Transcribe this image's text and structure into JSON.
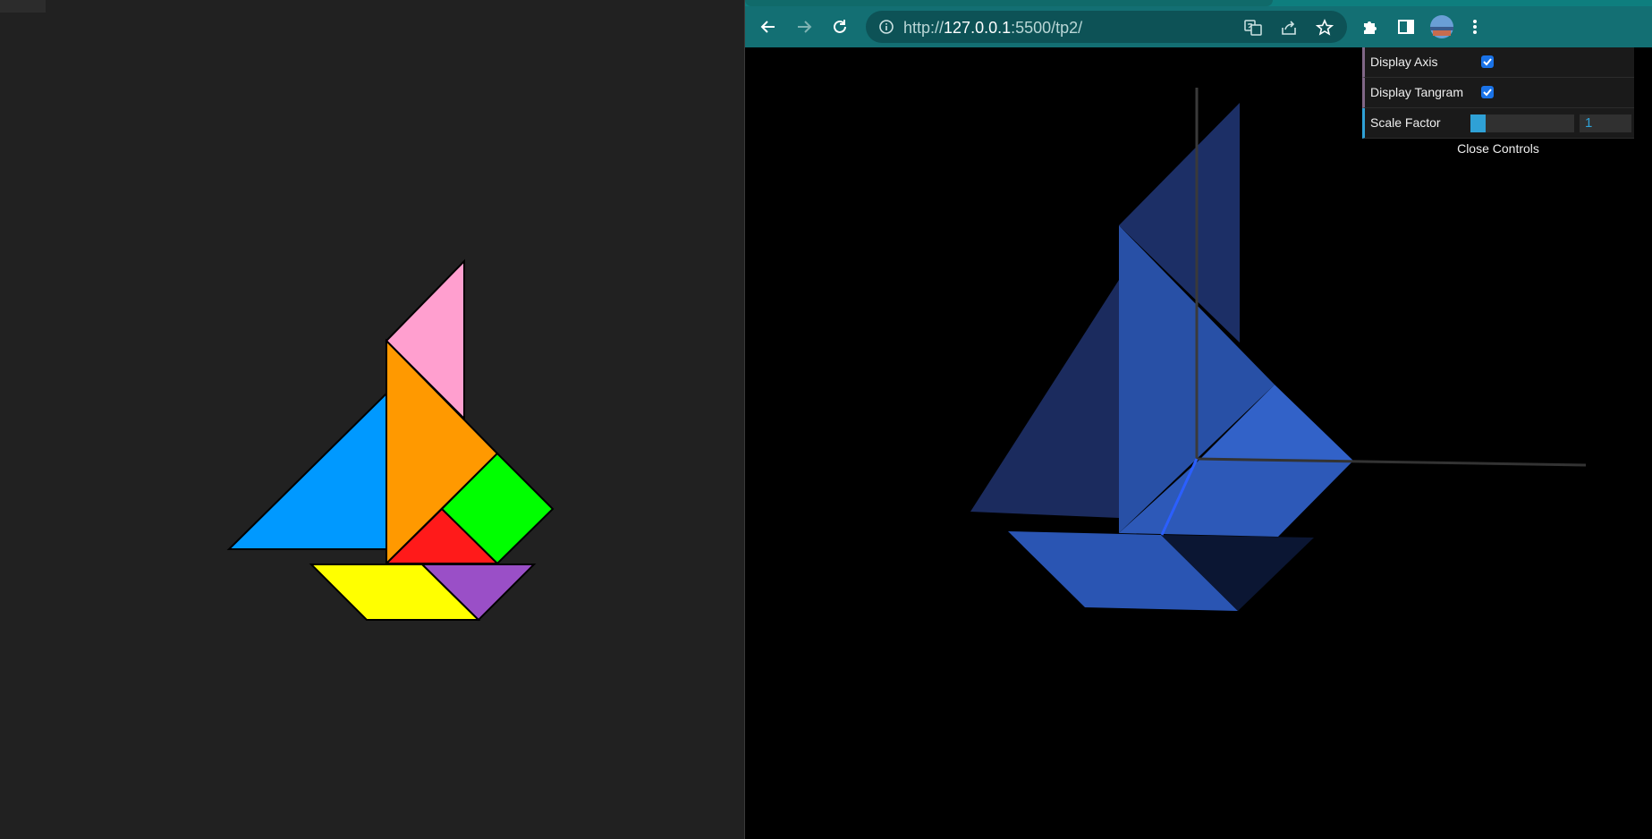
{
  "browser": {
    "url_prefix": "http://",
    "url_host": "127.0.0.1",
    "url_path": ":5500/tp2/"
  },
  "controls": {
    "display_axis_label": "Display Axis",
    "display_axis_checked": true,
    "display_tangram_label": "Display Tangram",
    "display_tangram_checked": true,
    "scale_factor_label": "Scale Factor",
    "scale_factor_value": "1",
    "scale_factor_fill": 0.15,
    "close_label": "Close Controls"
  },
  "colors": {
    "left_background": "#212121",
    "browser_frame": "#136f73",
    "slider_accent": "#2fa1d6",
    "tangram_pink": "#ff9fcf",
    "tangram_orange": "#ff9900",
    "tangram_blue": "#0099ff",
    "tangram_green": "#00ff00",
    "tangram_red": "#ff1a1a",
    "tangram_yellow": "#ffff00",
    "tangram_purple": "#9a4fc7",
    "scene_blue": "#2e5bbf"
  },
  "icons": {
    "back": "arrow-left-icon",
    "forward": "arrow-right-icon",
    "reload": "reload-icon",
    "info": "info-icon",
    "translate": "translate-icon",
    "share": "share-icon",
    "bookmark": "star-icon",
    "extensions": "puzzle-icon",
    "side_panel": "side-panel-icon",
    "profile": "avatar",
    "menu": "kebab-menu-icon"
  }
}
